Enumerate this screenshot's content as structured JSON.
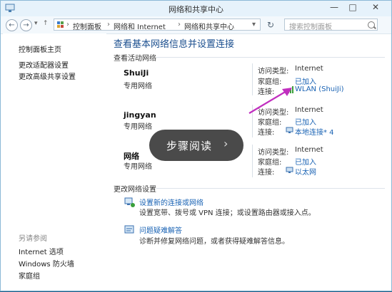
{
  "window": {
    "title": "网络和共享中心",
    "controls": [
      "—",
      "□",
      "✕"
    ]
  },
  "address_bar": {
    "breadcrumbs": [
      "控制面板",
      "网络和 Internet",
      "网络和共享中心"
    ],
    "search_placeholder": "搜索控制面板"
  },
  "sidebar": {
    "links": [
      "控制面板主页",
      "更改适配器设置",
      "更改高级共享设置"
    ],
    "see_also_heading": "另请参阅",
    "see_also_links": [
      "Internet 选项",
      "Windows 防火墙",
      "家庭组"
    ]
  },
  "main": {
    "heading": "查看基本网络信息并设置连接",
    "active_networks_label": "查看活动网络",
    "labels": {
      "access_type": "访问类型:",
      "homegroup": "家庭组:",
      "connection": "连接:"
    },
    "networks": [
      {
        "name": "ShuiJi",
        "type": "专用网络",
        "access": "Internet",
        "homegroup": "已加入",
        "connection": "WLAN (ShuiJi)"
      },
      {
        "name": "jingyan",
        "type": "专用网络",
        "access": "Internet",
        "homegroup": "已加入",
        "connection": "本地连接* 4"
      },
      {
        "name": "网络",
        "type": "专用网络",
        "access": "Internet",
        "homegroup": "已加入",
        "connection": "以太网"
      }
    ],
    "change_settings_label": "更改网络设置",
    "tasks": [
      {
        "link": "设置新的连接或网络",
        "desc": "设置宽带、拨号或 VPN 连接；或设置路由器或接入点。"
      },
      {
        "link": "问题疑难解答",
        "desc": "诊断并修复网络问题，或者获得疑难解答信息。"
      }
    ]
  },
  "overlay": {
    "label": "步骤阅读",
    "chevron": "›"
  },
  "colors": {
    "link": "#1a63b4",
    "heading": "#1b4f8f",
    "arrow": "#c12fbf",
    "titlebar": "#e6f2fb"
  }
}
